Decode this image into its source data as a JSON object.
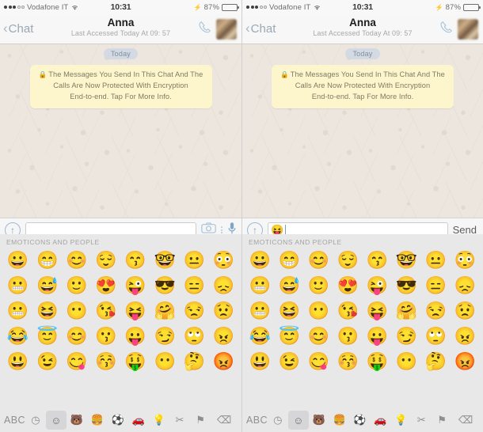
{
  "status_bar": {
    "signal_filled": 3,
    "signal_hollow": 2,
    "carrier": "Vodafone IT",
    "wifi_icon": "wifi-icon",
    "time": "10:31",
    "charging_icon": "lightning-bolt-icon",
    "battery_percent": "87%",
    "battery_level": 87
  },
  "nav_bar": {
    "back_label": "Chat",
    "back_icon": "chevron-left-icon",
    "title": "Anna",
    "subtitle": "Last Accessed Today At 09: 57",
    "call_icon": "phone-icon",
    "avatar_name": "contact-avatar"
  },
  "chat": {
    "day_divider_left": "Today",
    "day_divider_right": "Today",
    "encryption_notice": {
      "lock_icon": "lock-icon",
      "line1": "The Messages You Send In This Chat And The",
      "line2": "Calls Are Now Protected With Encryption",
      "line3": "End-to-end. Tap For More Info."
    }
  },
  "input_bar_left": {
    "attach_icon": "arrow-up-circle-icon",
    "field_value": "",
    "field_placeholder": "",
    "camera_icon": "camera-icon",
    "more_icon": "more-vertical-icon",
    "mic_icon": "microphone-icon"
  },
  "input_bar_right": {
    "attach_icon": "arrow-up-circle-icon",
    "field_value": "😝",
    "field_placeholder": "",
    "send_label": "Send"
  },
  "keyboard": {
    "section_label": "EMOTICONS AND PEOPLE",
    "emojis": [
      "😀",
      "😁",
      "😊",
      "😌",
      "😙",
      "🤓",
      "😐",
      "😳",
      "😬",
      "😅",
      "🙂",
      "😍",
      "😜",
      "😎",
      "😑",
      "😞",
      "😬",
      "😆",
      "😶",
      "😘",
      "😝",
      "🤗",
      "😒",
      "😟",
      "😂",
      "😇",
      "😊",
      "😗",
      "😛",
      "😏",
      "🙄",
      "😠",
      "😃",
      "😉",
      "😋",
      "😚",
      "🤑",
      "😶",
      "🤔",
      "😡"
    ],
    "bottom_keys": [
      {
        "label": "ABC",
        "icon": "abc-key",
        "active": false
      },
      {
        "label": "◷",
        "icon": "clock-recent-icon",
        "active": false
      },
      {
        "label": "☺",
        "icon": "smiley-category-icon",
        "active": true
      },
      {
        "label": "🐻",
        "icon": "animals-category-icon",
        "active": false
      },
      {
        "label": "🍔",
        "icon": "food-category-icon",
        "active": false
      },
      {
        "label": "⚽",
        "icon": "sports-category-icon",
        "active": false
      },
      {
        "label": "🚗",
        "icon": "travel-category-icon",
        "active": false
      },
      {
        "label": "💡",
        "icon": "objects-category-icon",
        "active": false
      },
      {
        "label": "✂",
        "icon": "symbols-category-icon",
        "active": false
      },
      {
        "label": "⚑",
        "icon": "flags-category-icon",
        "active": false
      },
      {
        "label": "⌫",
        "icon": "backspace-icon",
        "active": false
      }
    ]
  }
}
